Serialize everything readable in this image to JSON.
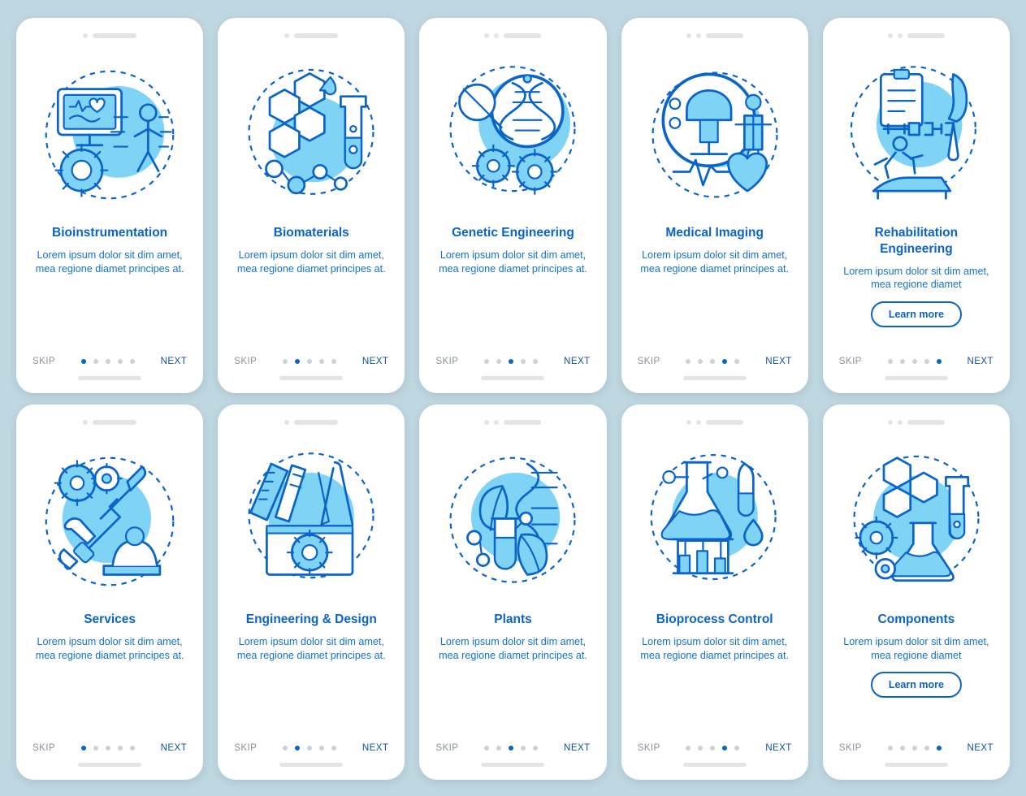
{
  "meta": {
    "background_color": "#bfd7e0",
    "accent_color": "#0b64c8",
    "blob_color": "#7fd4f5",
    "skip_label": "SKIP",
    "next_label": "NEXT",
    "learn_more_label": "Learn more",
    "total_dots": 5
  },
  "screens": [
    {
      "title": "Bioinstrumentation",
      "description": "Lorem ipsum dolor sit dim amet, mea regione diamet principes at.",
      "icon": "bioinstrumentation-icon",
      "active_dot": 1,
      "has_learn_more": false,
      "notch_dots": 1
    },
    {
      "title": "Biomaterials",
      "description": "Lorem ipsum dolor sit dim amet, mea regione diamet principes at.",
      "icon": "biomaterials-icon",
      "active_dot": 2,
      "has_learn_more": false,
      "notch_dots": 1
    },
    {
      "title": "Genetic Engineering",
      "description": "Lorem ipsum dolor sit dim amet, mea regione diamet principes at.",
      "icon": "genetic-engineering-icon",
      "active_dot": 3,
      "has_learn_more": false,
      "notch_dots": 2
    },
    {
      "title": "Medical Imaging",
      "description": "Lorem ipsum dolor sit dim amet, mea regione diamet principes at.",
      "icon": "medical-imaging-icon",
      "active_dot": 4,
      "has_learn_more": false,
      "notch_dots": 2
    },
    {
      "title": "Rehabilitation Engineering",
      "description": "Lorem ipsum dolor sit dim amet, mea regione diamet",
      "icon": "rehabilitation-engineering-icon",
      "active_dot": 5,
      "has_learn_more": true,
      "notch_dots": 2
    },
    {
      "title": "Services",
      "description": "Lorem ipsum dolor sit dim amet, mea regione diamet principes at.",
      "icon": "services-icon",
      "active_dot": 1,
      "has_learn_more": false,
      "notch_dots": 1
    },
    {
      "title": "Engineering & Design",
      "description": "Lorem ipsum dolor sit dim amet, mea regione diamet principes at.",
      "icon": "engineering-design-icon",
      "active_dot": 2,
      "has_learn_more": false,
      "notch_dots": 1
    },
    {
      "title": "Plants",
      "description": "Lorem ipsum dolor sit dim amet, mea regione diamet principes at.",
      "icon": "plants-icon",
      "active_dot": 3,
      "has_learn_more": false,
      "notch_dots": 2
    },
    {
      "title": "Bioprocess Control",
      "description": "Lorem ipsum dolor sit dim amet, mea regione diamet principes at.",
      "icon": "bioprocess-control-icon",
      "active_dot": 4,
      "has_learn_more": false,
      "notch_dots": 2
    },
    {
      "title": "Components",
      "description": "Lorem ipsum dolor sit dim amet, mea regione diamet",
      "icon": "components-icon",
      "active_dot": 5,
      "has_learn_more": true,
      "notch_dots": 2
    }
  ]
}
